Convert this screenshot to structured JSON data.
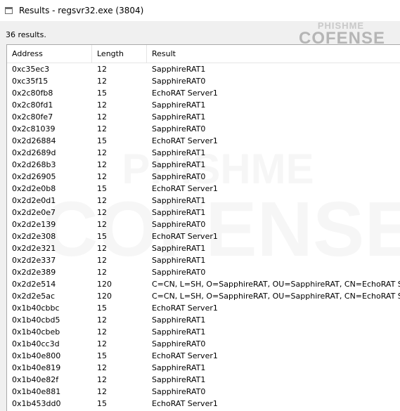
{
  "window": {
    "title": "Results - regsvr32.exe (3804)"
  },
  "results_count": "36 results.",
  "columns": {
    "address": "Address",
    "length": "Length",
    "result": "Result"
  },
  "rows": [
    {
      "address": "0xc35ec3",
      "length": "12",
      "result": "SapphireRAT1"
    },
    {
      "address": "0xc35f15",
      "length": "12",
      "result": "SapphireRAT0"
    },
    {
      "address": "0x2c80fb8",
      "length": "15",
      "result": "EchoRAT Server1"
    },
    {
      "address": "0x2c80fd1",
      "length": "12",
      "result": "SapphireRAT1"
    },
    {
      "address": "0x2c80fe7",
      "length": "12",
      "result": "SapphireRAT1"
    },
    {
      "address": "0x2c81039",
      "length": "12",
      "result": "SapphireRAT0"
    },
    {
      "address": "0x2d26884",
      "length": "15",
      "result": "EchoRAT Server1"
    },
    {
      "address": "0x2d2689d",
      "length": "12",
      "result": "SapphireRAT1"
    },
    {
      "address": "0x2d268b3",
      "length": "12",
      "result": "SapphireRAT1"
    },
    {
      "address": "0x2d26905",
      "length": "12",
      "result": "SapphireRAT0"
    },
    {
      "address": "0x2d2e0b8",
      "length": "15",
      "result": "EchoRAT Server1"
    },
    {
      "address": "0x2d2e0d1",
      "length": "12",
      "result": "SapphireRAT1"
    },
    {
      "address": "0x2d2e0e7",
      "length": "12",
      "result": "SapphireRAT1"
    },
    {
      "address": "0x2d2e139",
      "length": "12",
      "result": "SapphireRAT0"
    },
    {
      "address": "0x2d2e308",
      "length": "15",
      "result": "EchoRAT Server1"
    },
    {
      "address": "0x2d2e321",
      "length": "12",
      "result": "SapphireRAT1"
    },
    {
      "address": "0x2d2e337",
      "length": "12",
      "result": "SapphireRAT1"
    },
    {
      "address": "0x2d2e389",
      "length": "12",
      "result": "SapphireRAT0"
    },
    {
      "address": "0x2d2e514",
      "length": "120",
      "result": "C=CN, L=SH, O=SapphireRAT, OU=SapphireRAT, CN=EchoRAT Server"
    },
    {
      "address": "0x2d2e5ac",
      "length": "120",
      "result": "C=CN, L=SH, O=SapphireRAT, OU=SapphireRAT, CN=EchoRAT Server"
    },
    {
      "address": "0x1b40cbbc",
      "length": "15",
      "result": "EchoRAT Server1"
    },
    {
      "address": "0x1b40cbd5",
      "length": "12",
      "result": "SapphireRAT1"
    },
    {
      "address": "0x1b40cbeb",
      "length": "12",
      "result": "SapphireRAT1"
    },
    {
      "address": "0x1b40cc3d",
      "length": "12",
      "result": "SapphireRAT0"
    },
    {
      "address": "0x1b40e800",
      "length": "15",
      "result": "EchoRAT Server1"
    },
    {
      "address": "0x1b40e819",
      "length": "12",
      "result": "SapphireRAT1"
    },
    {
      "address": "0x1b40e82f",
      "length": "12",
      "result": "SapphireRAT1"
    },
    {
      "address": "0x1b40e881",
      "length": "12",
      "result": "SapphireRAT0"
    },
    {
      "address": "0x1b453dd0",
      "length": "15",
      "result": "EchoRAT Server1"
    }
  ],
  "watermark": {
    "top": "PHISHME",
    "bottom": "COFENSE"
  }
}
